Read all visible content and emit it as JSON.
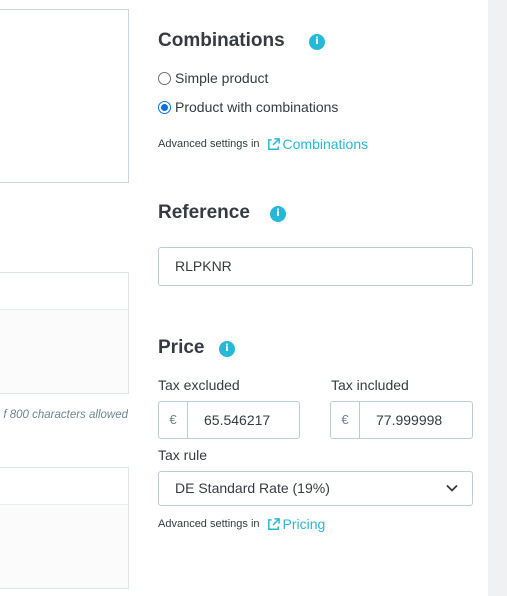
{
  "left": {
    "char_count_text": "f 800 characters allowed"
  },
  "combinations": {
    "title": "Combinations",
    "options": [
      {
        "label": "Simple product",
        "checked": false
      },
      {
        "label": "Product with combinations",
        "checked": true
      }
    ],
    "advanced_prefix": "Advanced settings in",
    "advanced_link": "Combinations"
  },
  "reference": {
    "title": "Reference",
    "value": "RLPKNR"
  },
  "price": {
    "title": "Price",
    "tax_excluded_label": "Tax excluded",
    "tax_included_label": "Tax included",
    "currency_symbol": "€",
    "tax_excluded_value": "65.546217",
    "tax_included_value": "77.999998",
    "tax_rule_label": "Tax rule",
    "tax_rule_value": "DE Standard Rate (19%)",
    "advanced_prefix": "Advanced settings in",
    "advanced_link": "Pricing"
  },
  "colors": {
    "accent": "#25b9d7",
    "border": "#bbcdd2",
    "text": "#363a41"
  },
  "icons": [
    "info-icon",
    "external-link-icon",
    "chevron-down-icon"
  ]
}
